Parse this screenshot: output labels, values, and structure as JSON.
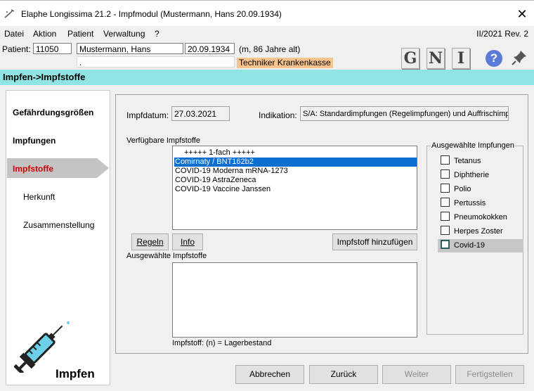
{
  "window": {
    "title": "Elaphe Longissima 21.2 - Impfmodul (Mustermann, Hans  20.09.1934)",
    "close_glyph": "✕"
  },
  "menu": {
    "items": [
      "Datei",
      "Aktion",
      "Patient",
      "Verwaltung",
      "?"
    ],
    "version": "II/2021 Rev. 2"
  },
  "patient": {
    "label": "Patient:",
    "id": "11050",
    "name": "Mustermann, Hans",
    "birthdate": "20.09.1934",
    "age_text": "(m, 86 Jahre alt)",
    "address": ".",
    "insurance": "Techniker Krankenkasse"
  },
  "toolbar": {
    "g_label": "G",
    "n_label": "N",
    "i_label": "I",
    "help_label": "?"
  },
  "breadcrumb": "Impfen->Impfstoffe",
  "sidebar": {
    "items": [
      {
        "label": "Gefährdungsgrößen"
      },
      {
        "label": "Impfungen"
      },
      {
        "label": "Impfstoffe"
      },
      {
        "label": "Herkunft"
      },
      {
        "label": "Zusammenstellung"
      }
    ],
    "footer_label": "Impfen"
  },
  "form": {
    "impfdatum_label": "Impfdatum:",
    "impfdatum_value": "27.03.2021",
    "indikation_label": "Indikation:",
    "indikation_value": "S/A:  Standardimpfungen (Regelimpfungen) und Auffrischimp",
    "available_label": "Verfügbare Impfstoffe",
    "available_items": [
      "+++++ 1-fach +++++",
      "Comirnaty / BNT162b2",
      "COVID-19 Moderna mRNA-1273",
      "COVID-19 AstraZeneca",
      "COVID-19 Vaccine Janssen"
    ],
    "selected_index": 1,
    "btn_regeln": "Regeln",
    "btn_info": "Info",
    "btn_add": "Impfstoff hinzufügen",
    "selected_label": "Ausgewählte Impfstoffe",
    "footnote": "Impfstoff: (n) = Lagerbestand"
  },
  "selected_impfungen": {
    "title": "Ausgewählte Impfungen",
    "items": [
      {
        "label": "Tetanus",
        "checked": false
      },
      {
        "label": "Diphtherie",
        "checked": false
      },
      {
        "label": "Polio",
        "checked": false
      },
      {
        "label": "Pertussis",
        "checked": false
      },
      {
        "label": "Pneumokokken",
        "checked": false
      },
      {
        "label": "Herpes Zoster",
        "checked": false
      },
      {
        "label": "Covid-19",
        "checked": false
      }
    ]
  },
  "bottom_buttons": {
    "abbrechen": "Abbrechen",
    "zurueck": "Zurück",
    "weiter": "Weiter",
    "fertigstellen": "Fertigstellen"
  },
  "colors": {
    "breadcrumb_bg": "#90e4e4",
    "active_nav": "#cc0000",
    "selection": "#0a6fd1",
    "insurance_bg": "#f6c48c"
  }
}
